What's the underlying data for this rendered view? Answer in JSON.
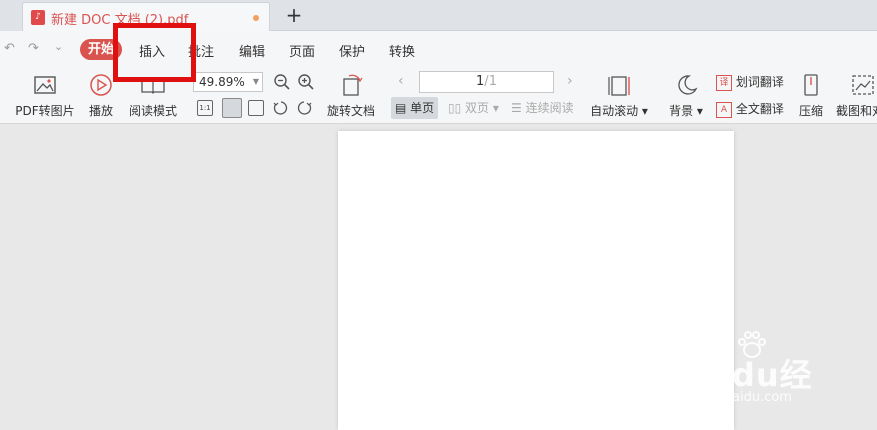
{
  "tabbar": {
    "doc_icon": "pdf-icon",
    "doc_title": "新建 DOC 文档 (2).pdf",
    "new_tab": "+"
  },
  "menubar": {
    "undo": "↶",
    "redo": "↷",
    "more": "⌄",
    "items": [
      "开始",
      "插入",
      "批注",
      "编辑",
      "页面",
      "保护",
      "转换"
    ]
  },
  "toolbar": {
    "pdf_to_image": "PDF转图片",
    "play": "播放",
    "read_mode": "阅读模式",
    "zoom": "49.89%",
    "rotate_doc": "旋转文档",
    "page_current": "1",
    "page_total": "1",
    "single_page": "单页",
    "double_page": "双页",
    "continuous": "连续阅读",
    "auto_scroll": "自动滚动",
    "background": "背景",
    "word_translate": "划词翻译",
    "full_translate": "全文翻译",
    "compress": "压缩",
    "screenshot": "截图和对"
  },
  "watermark": {
    "main": "Baidu经验",
    "sub": "jingyan.baidu.com"
  },
  "colors": {
    "accent": "#d9534f",
    "highlight_box": "#e01010"
  }
}
